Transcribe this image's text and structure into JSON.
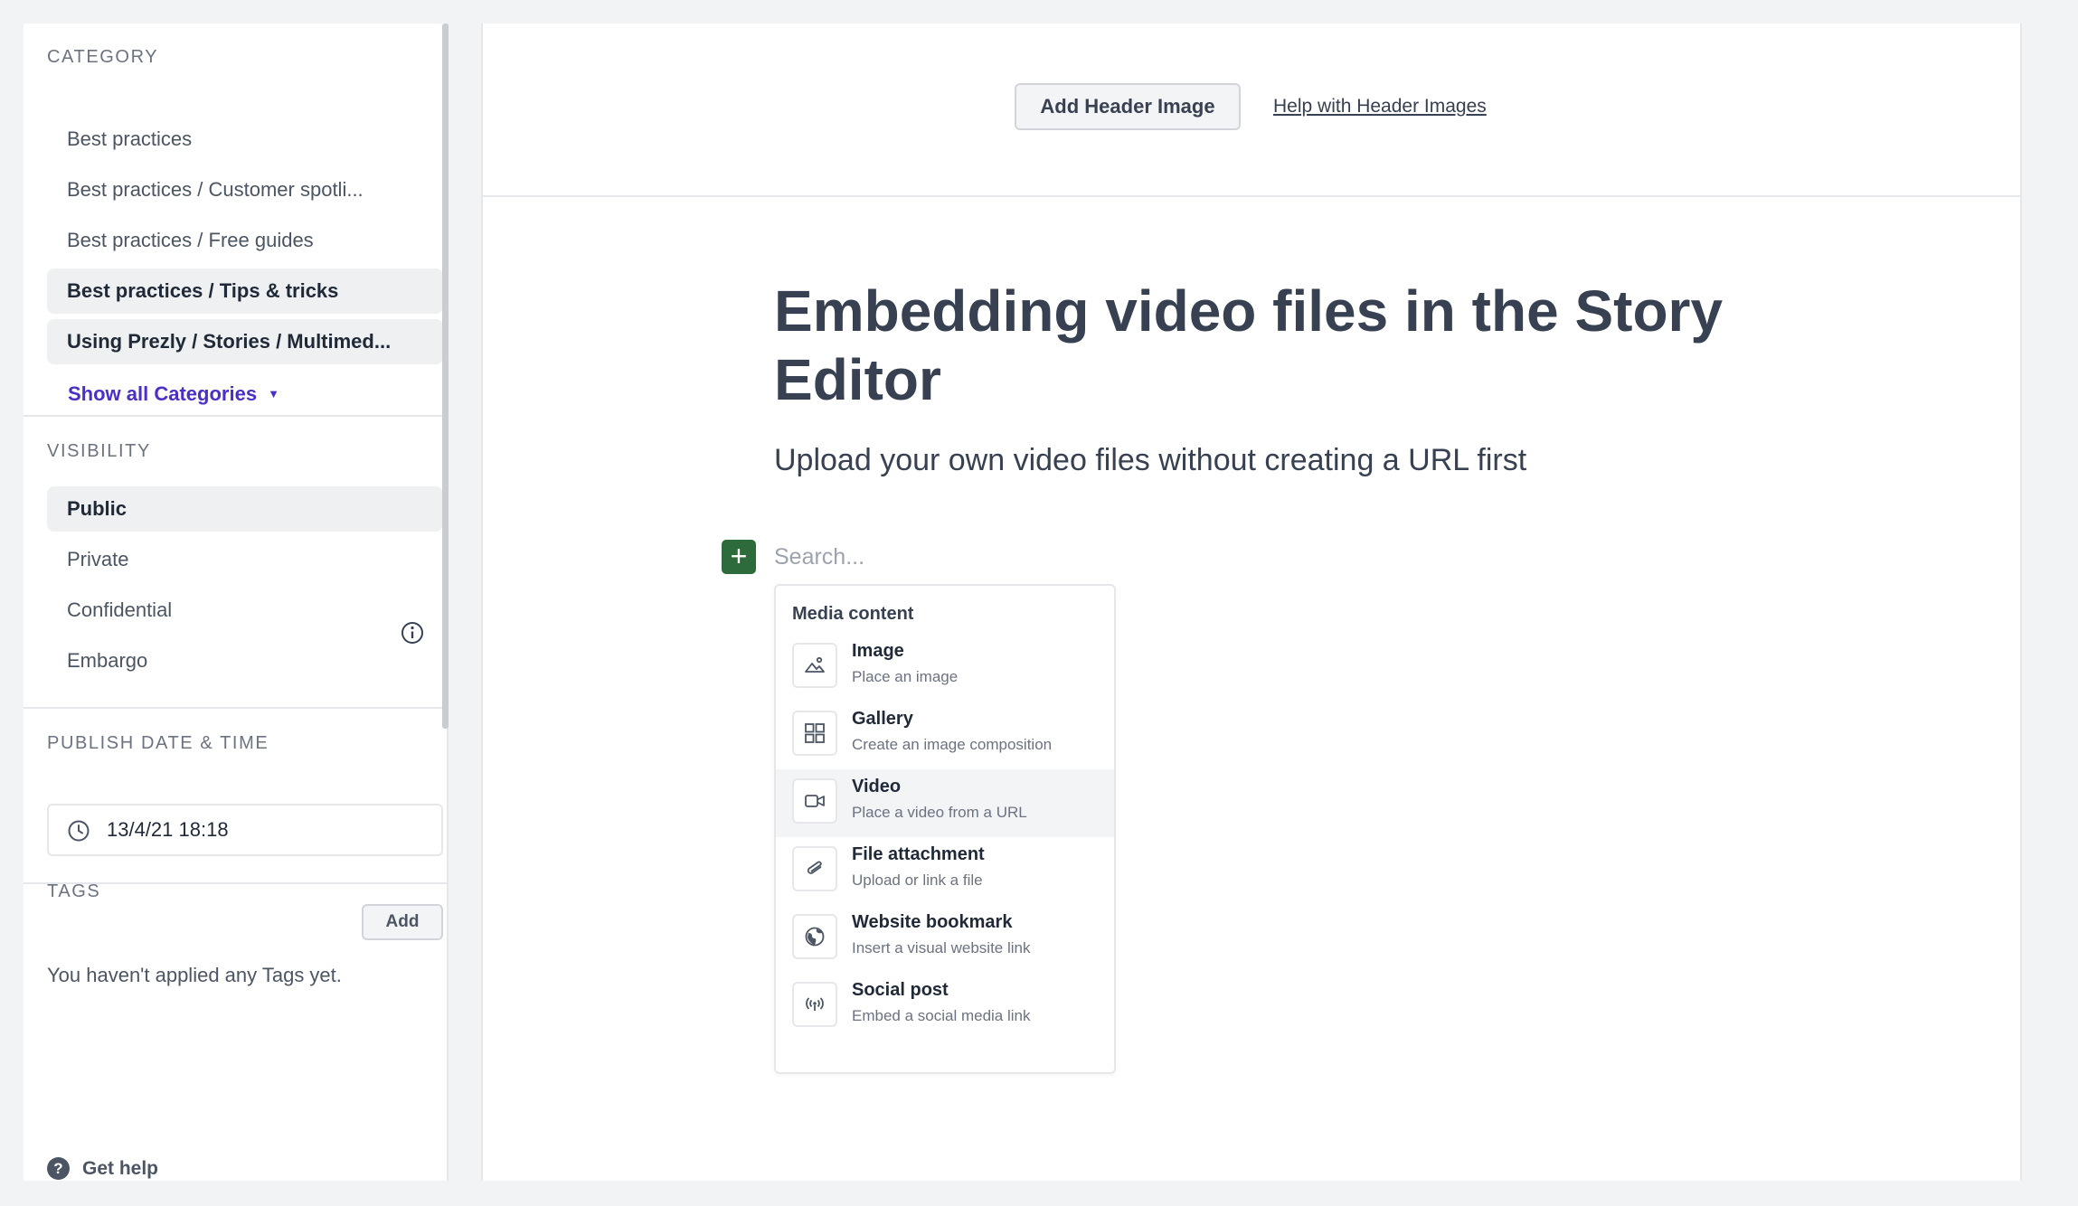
{
  "sidebar": {
    "category": {
      "title": "CATEGORY",
      "items": [
        {
          "label": "Best practices",
          "selected": false
        },
        {
          "label": "Best practices / Customer spotli...",
          "selected": false
        },
        {
          "label": "Best practices / Free guides",
          "selected": false
        },
        {
          "label": "Best practices / Tips & tricks",
          "selected": true
        },
        {
          "label": "Using Prezly / Stories / Multimed...",
          "selected": true
        }
      ],
      "show_all_label": "Show all Categories"
    },
    "visibility": {
      "title": "VISIBILITY",
      "options": [
        {
          "label": "Public",
          "selected": true
        },
        {
          "label": "Private",
          "selected": false
        },
        {
          "label": "Confidential",
          "selected": false,
          "icon": "info-icon"
        },
        {
          "label": "Embargo",
          "selected": false
        }
      ]
    },
    "publish": {
      "title": "PUBLISH DATE & TIME",
      "value": "13/4/21 18:18",
      "icon": "clock-icon"
    },
    "tags": {
      "title": "TAGS",
      "add_label": "Add",
      "empty_text": "You haven't applied any Tags yet."
    },
    "help": {
      "label": "Get help",
      "icon_glyph": "?"
    }
  },
  "editor": {
    "header": {
      "add_button": "Add Header Image",
      "help_link": "Help with Header Images"
    },
    "title": "Embedding video files in the Story Editor",
    "subtitle": "Upload your own video files without creating a URL first",
    "insert_button_glyph": "+",
    "search_placeholder": "Search...",
    "dropdown": {
      "heading": "Media content",
      "items": [
        {
          "label": "Image",
          "desc": "Place an image",
          "icon": "image-icon",
          "active": false
        },
        {
          "label": "Gallery",
          "desc": "Create an image composition",
          "icon": "gallery-icon",
          "active": false
        },
        {
          "label": "Video",
          "desc": "Place a video from a URL",
          "icon": "video-icon",
          "active": true
        },
        {
          "label": "File attachment",
          "desc": "Upload or link a file",
          "icon": "paperclip-icon",
          "active": false
        },
        {
          "label": "Website bookmark",
          "desc": "Insert a visual website link",
          "icon": "globe-icon",
          "active": false
        },
        {
          "label": "Social post",
          "desc": "Embed a social media link",
          "icon": "broadcast-icon",
          "active": false
        }
      ]
    }
  },
  "colors": {
    "accent_link": "#4b2fc7",
    "insert_button": "#2e6b3a",
    "selected_bg": "#eef0f2"
  }
}
